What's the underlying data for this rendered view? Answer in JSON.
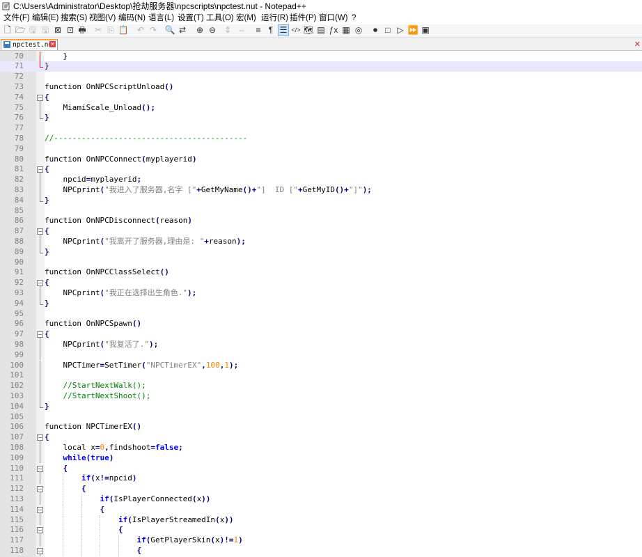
{
  "window": {
    "title": "C:\\Users\\Administrator\\Desktop\\抢劫服务器\\npcscripts\\npctest.nut - Notepad++"
  },
  "menu": [
    "文件(F)",
    "编辑(E)",
    "搜索(S)",
    "视图(V)",
    "编码(N)",
    "语言(L)",
    "设置(T)",
    "工具(O)",
    "宏(M)",
    "运行(R)",
    "插件(P)",
    "窗口(W)",
    "?"
  ],
  "toolbar": [
    {
      "name": "new-file-icon",
      "glyph": "🗋"
    },
    {
      "name": "open-file-icon",
      "glyph": "🗁"
    },
    {
      "name": "save-icon",
      "glyph": "🖫"
    },
    {
      "name": "save-all-icon",
      "glyph": "🖫"
    },
    {
      "name": "close-icon",
      "glyph": "⊠"
    },
    {
      "name": "close-all-icon",
      "glyph": "⊡"
    },
    {
      "name": "print-icon",
      "glyph": "🖶"
    },
    {
      "name": "cut-icon",
      "glyph": "✂"
    },
    {
      "name": "copy-icon",
      "glyph": "⎘"
    },
    {
      "name": "paste-icon",
      "glyph": "📋"
    },
    {
      "name": "undo-icon",
      "glyph": "↶"
    },
    {
      "name": "redo-icon",
      "glyph": "↷"
    },
    {
      "name": "find-icon",
      "glyph": "🔍"
    },
    {
      "name": "replace-icon",
      "glyph": "⇄"
    },
    {
      "name": "zoom-in-icon",
      "glyph": "⊕"
    },
    {
      "name": "zoom-out-icon",
      "glyph": "⊖"
    },
    {
      "name": "sync-vertical-icon",
      "glyph": "⇕"
    },
    {
      "name": "sync-horizontal-icon",
      "glyph": "⇔"
    },
    {
      "name": "word-wrap-icon",
      "glyph": "≡"
    },
    {
      "name": "show-all-chars-icon",
      "glyph": "¶"
    },
    {
      "name": "indent-guide-icon",
      "glyph": "☰"
    },
    {
      "name": "xml-icon",
      "glyph": "</>"
    },
    {
      "name": "doc-map-icon",
      "glyph": "🗺"
    },
    {
      "name": "doc-list-icon",
      "glyph": "▤"
    },
    {
      "name": "function-list-icon",
      "glyph": "ƒx"
    },
    {
      "name": "folder-workspace-icon",
      "glyph": "▦"
    },
    {
      "name": "monitoring-icon",
      "glyph": "◎"
    },
    {
      "name": "record-macro-icon",
      "glyph": "⏺"
    },
    {
      "name": "stop-macro-icon",
      "glyph": "□"
    },
    {
      "name": "play-macro-icon",
      "glyph": "▷"
    },
    {
      "name": "run-macro-multiple-icon",
      "glyph": "⏩"
    },
    {
      "name": "save-macro-icon",
      "glyph": "▣"
    }
  ],
  "tab": {
    "name": "npctest.nut"
  },
  "editor": {
    "current_line": 71,
    "lines": [
      {
        "n": "70",
        "fold": "red-line",
        "code": [
          [
            "",
            "    }"
          ]
        ]
      },
      {
        "n": "71",
        "fold": "red-end",
        "code": [
          [
            "",
            "}"
          ]
        ]
      },
      {
        "n": "72",
        "fold": "",
        "code": []
      },
      {
        "n": "73",
        "fold": "",
        "code": [
          [
            "",
            "function OnNPCScriptUnload"
          ],
          [
            "op",
            "()"
          ]
        ]
      },
      {
        "n": "74",
        "fold": "box",
        "code": [
          [
            "op",
            "{"
          ]
        ]
      },
      {
        "n": "75",
        "fold": "line",
        "code": [
          [
            "",
            "    MiamiScale_Unload"
          ],
          [
            "op",
            "();"
          ]
        ]
      },
      {
        "n": "76",
        "fold": "end",
        "code": [
          [
            "op",
            "}"
          ]
        ]
      },
      {
        "n": "77",
        "fold": "",
        "code": []
      },
      {
        "n": "78",
        "fold": "",
        "code": [
          [
            "cm",
            "//------------------------------------------"
          ]
        ]
      },
      {
        "n": "79",
        "fold": "",
        "code": []
      },
      {
        "n": "80",
        "fold": "",
        "code": [
          [
            "",
            "function OnNPCConnect"
          ],
          [
            "op",
            "("
          ],
          [
            "",
            "myplayerid"
          ],
          [
            "op",
            ")"
          ]
        ]
      },
      {
        "n": "81",
        "fold": "box",
        "code": [
          [
            "op",
            "{"
          ]
        ]
      },
      {
        "n": "82",
        "fold": "line",
        "code": [
          [
            "",
            "    npcid"
          ],
          [
            "op",
            "="
          ],
          [
            "",
            "myplayerid"
          ],
          [
            "op",
            ";"
          ]
        ]
      },
      {
        "n": "83",
        "fold": "line",
        "code": [
          [
            "",
            "    NPCprint"
          ],
          [
            "op",
            "("
          ],
          [
            "str",
            "\"我进入了服务器,名字 [\""
          ],
          [
            "op",
            "+"
          ],
          [
            "",
            "GetMyName"
          ],
          [
            "op",
            "()+"
          ],
          [
            "str",
            "\"]  ID [\""
          ],
          [
            "op",
            "+"
          ],
          [
            "",
            "GetMyID"
          ],
          [
            "op",
            "()+"
          ],
          [
            "str",
            "\"]\""
          ],
          [
            "op",
            ");"
          ]
        ]
      },
      {
        "n": "84",
        "fold": "end",
        "code": [
          [
            "op",
            "}"
          ]
        ]
      },
      {
        "n": "85",
        "fold": "",
        "code": []
      },
      {
        "n": "86",
        "fold": "",
        "code": [
          [
            "",
            "function OnNPCDisconnect"
          ],
          [
            "op",
            "("
          ],
          [
            "",
            "reason"
          ],
          [
            "op",
            ")"
          ]
        ]
      },
      {
        "n": "87",
        "fold": "box",
        "code": [
          [
            "op",
            "{"
          ]
        ]
      },
      {
        "n": "88",
        "fold": "line",
        "code": [
          [
            "",
            "    NPCprint"
          ],
          [
            "op",
            "("
          ],
          [
            "str",
            "\"我离开了服务器,理由是: \""
          ],
          [
            "op",
            "+"
          ],
          [
            "",
            "reason"
          ],
          [
            "op",
            ");"
          ]
        ]
      },
      {
        "n": "89",
        "fold": "end",
        "code": [
          [
            "op",
            "}"
          ]
        ]
      },
      {
        "n": "90",
        "fold": "",
        "code": []
      },
      {
        "n": "91",
        "fold": "",
        "code": [
          [
            "",
            "function OnNPCClassSelect"
          ],
          [
            "op",
            "()"
          ]
        ]
      },
      {
        "n": "92",
        "fold": "box",
        "code": [
          [
            "op",
            "{"
          ]
        ]
      },
      {
        "n": "93",
        "fold": "line",
        "code": [
          [
            "",
            "    NPCprint"
          ],
          [
            "op",
            "("
          ],
          [
            "str",
            "\"我正在选择出生角色.\""
          ],
          [
            "op",
            ");"
          ]
        ]
      },
      {
        "n": "94",
        "fold": "end",
        "code": [
          [
            "op",
            "}"
          ]
        ]
      },
      {
        "n": "95",
        "fold": "",
        "code": []
      },
      {
        "n": "96",
        "fold": "",
        "code": [
          [
            "",
            "function OnNPCSpawn"
          ],
          [
            "op",
            "()"
          ]
        ]
      },
      {
        "n": "97",
        "fold": "box",
        "code": [
          [
            "op",
            "{"
          ]
        ]
      },
      {
        "n": "98",
        "fold": "line",
        "code": [
          [
            "",
            "    NPCprint"
          ],
          [
            "op",
            "("
          ],
          [
            "str",
            "\"我复活了.\""
          ],
          [
            "op",
            ");"
          ]
        ]
      },
      {
        "n": "99",
        "fold": "line",
        "code": []
      },
      {
        "n": "100",
        "fold": "line",
        "code": [
          [
            "",
            "    NPCTimer"
          ],
          [
            "op",
            "="
          ],
          [
            "",
            "SetTimer"
          ],
          [
            "op",
            "("
          ],
          [
            "str",
            "\"NPCTimerEX\""
          ],
          [
            "op",
            ","
          ],
          [
            "num",
            "100"
          ],
          [
            "op",
            ","
          ],
          [
            "num",
            "1"
          ],
          [
            "op",
            ");"
          ]
        ]
      },
      {
        "n": "101",
        "fold": "line",
        "code": []
      },
      {
        "n": "102",
        "fold": "line",
        "code": [
          [
            "cm",
            "    //StartNextWalk();"
          ]
        ]
      },
      {
        "n": "103",
        "fold": "line",
        "code": [
          [
            "cm",
            "    //StartNextShoot();"
          ]
        ]
      },
      {
        "n": "104",
        "fold": "end",
        "code": [
          [
            "op",
            "}"
          ]
        ]
      },
      {
        "n": "105",
        "fold": "",
        "code": []
      },
      {
        "n": "106",
        "fold": "",
        "code": [
          [
            "",
            "function NPCTimerEX"
          ],
          [
            "op",
            "()"
          ]
        ]
      },
      {
        "n": "107",
        "fold": "box",
        "code": [
          [
            "op",
            "{"
          ]
        ]
      },
      {
        "n": "108",
        "fold": "line",
        "code": [
          [
            "",
            "    local x"
          ],
          [
            "op",
            "="
          ],
          [
            "num",
            "0"
          ],
          [
            "op",
            ","
          ],
          [
            "",
            "findshoot"
          ],
          [
            "op",
            "="
          ],
          [
            "kw",
            "false"
          ],
          [
            "op",
            ";"
          ]
        ]
      },
      {
        "n": "109",
        "fold": "line",
        "code": [
          [
            "kw",
            "    while"
          ],
          [
            "op",
            "("
          ],
          [
            "kw",
            "true"
          ],
          [
            "op",
            ")"
          ]
        ]
      },
      {
        "n": "110",
        "fold": "box",
        "code": [
          [
            "op",
            "    {"
          ]
        ]
      },
      {
        "n": "111",
        "fold": "line",
        "code": [
          [
            "kw",
            "        if"
          ],
          [
            "op",
            "("
          ],
          [
            "",
            "x"
          ],
          [
            "op",
            "!="
          ],
          [
            "",
            "npcid"
          ],
          [
            "op",
            ")"
          ]
        ]
      },
      {
        "n": "112",
        "fold": "box",
        "code": [
          [
            "op",
            "        {"
          ]
        ]
      },
      {
        "n": "113",
        "fold": "line",
        "code": [
          [
            "kw",
            "            if"
          ],
          [
            "op",
            "("
          ],
          [
            "",
            "IsPlayerConnected"
          ],
          [
            "op",
            "("
          ],
          [
            "",
            "x"
          ],
          [
            "op",
            "))"
          ]
        ]
      },
      {
        "n": "114",
        "fold": "box",
        "code": [
          [
            "op",
            "            {"
          ]
        ]
      },
      {
        "n": "115",
        "fold": "line",
        "code": [
          [
            "kw",
            "                if"
          ],
          [
            "op",
            "("
          ],
          [
            "",
            "IsPlayerStreamedIn"
          ],
          [
            "op",
            "("
          ],
          [
            "",
            "x"
          ],
          [
            "op",
            "))"
          ]
        ]
      },
      {
        "n": "116",
        "fold": "box",
        "code": [
          [
            "op",
            "                {"
          ]
        ]
      },
      {
        "n": "117",
        "fold": "line",
        "code": [
          [
            "kw",
            "                    if"
          ],
          [
            "op",
            "("
          ],
          [
            "",
            "GetPlayerSkin"
          ],
          [
            "op",
            "("
          ],
          [
            "",
            "x"
          ],
          [
            "op",
            ")!="
          ],
          [
            "num",
            "1"
          ],
          [
            "op",
            ")"
          ]
        ]
      },
      {
        "n": "118",
        "fold": "box",
        "code": [
          [
            "op",
            "                    {"
          ]
        ]
      }
    ]
  }
}
